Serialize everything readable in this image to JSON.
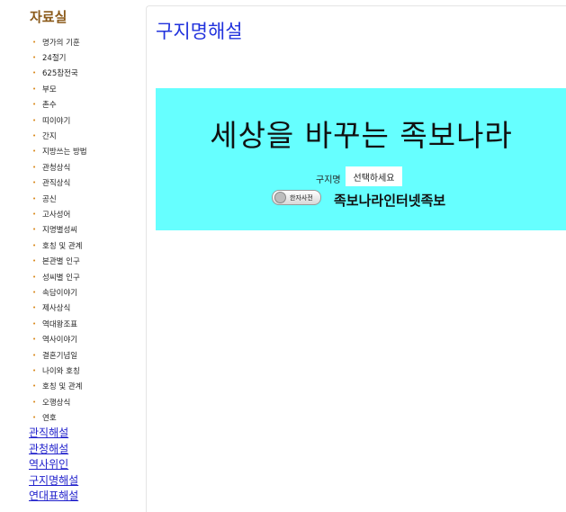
{
  "sidebar": {
    "title": "자료실",
    "bullet_icon": "dot-bullet",
    "items": [
      "명가의 기훈",
      "24절기",
      "625참전국",
      "부모",
      "촌수",
      "띠이야기",
      "간지",
      "지방쓰는 방법",
      "관청상식",
      "관직상식",
      "공신",
      "고사성어",
      "지명별성씨",
      "호칭 및 관계",
      "본관별 인구",
      "성씨별 인구",
      "속담이야기",
      "제사상식",
      "역대왕조표",
      "역사이야기",
      "결혼기념일",
      "나이와 호칭",
      "호칭 및 관계",
      "오행상식",
      "연호"
    ],
    "links": [
      "관직해설",
      "관청해설",
      "역사위인",
      "구지명해설",
      "연대표해설"
    ]
  },
  "main": {
    "title": "구지명해설",
    "banner": {
      "headline": "세상을 바꾸는 족보나라",
      "field_label": "구지명",
      "select_value": "선택하세요",
      "dict_button": "한자사전",
      "brand": "족보나라인터넷족보",
      "bg_color": "#66ffff"
    }
  }
}
